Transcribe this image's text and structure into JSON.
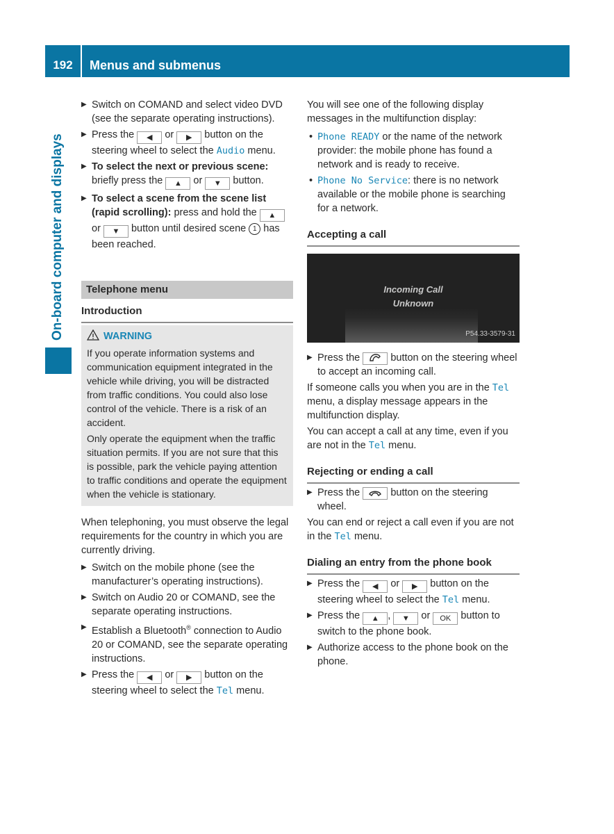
{
  "header": {
    "page_number": "192",
    "title": "Menus and submenus"
  },
  "side_tab": {
    "label": "On-board computer and displays"
  },
  "left": {
    "steps_top": [
      {
        "text": "Switch on COMAND and select video DVD (see the separate operating instructions)."
      },
      {
        "pre": "Press the",
        "key1": "◀",
        "mid": "or",
        "key2": "▶",
        "post": "button on the steering wheel to select the",
        "mono": "Audio",
        "end": "menu."
      },
      {
        "bold": "To select the next or previous scene:",
        "pre": "briefly press the",
        "key1": "▲",
        "mid": "or",
        "key2": "▼",
        "post": "button."
      },
      {
        "bold": "To select a scene from the scene list (rapid scrolling):",
        "pre": "press and hold the",
        "key1": "▲",
        "mid": "or",
        "key2": "▼",
        "post": "button until desired scene",
        "circ": "1",
        "end": "has been reached."
      }
    ],
    "section_title": "Telephone menu",
    "intro_heading": "Introduction",
    "warning": {
      "title": "WARNING",
      "p1": "If you operate information systems and communication equipment integrated in the vehicle while driving, you will be distracted from traffic conditions. You could also lose control of the vehicle. There is a risk of an accident.",
      "p2": "Only operate the equipment when the traffic situation permits. If you are not sure that this is possible, park the vehicle paying attention to traffic conditions and operate the equipment when the vehicle is stationary."
    },
    "intro_para": "When telephoning, you must observe the legal requirements for the country in which you are currently driving.",
    "steps_bottom": [
      {
        "text": "Switch on the mobile phone (see the manufacturer’s operating instructions)."
      },
      {
        "text": "Switch on Audio 20 or COMAND, see the separate operating instructions."
      },
      {
        "pre": "Establish a Bluetooth",
        "sup": "®",
        "post": " connection to Audio 20 or COMAND, see the separate operating instructions."
      },
      {
        "pre": "Press the",
        "key1": "◀",
        "mid": "or",
        "key2": "▶",
        "post": "button on the steering wheel to select the",
        "mono": "Tel",
        "end": "menu."
      }
    ]
  },
  "right": {
    "intro": "You will see one of the following display messages in the multifunction display:",
    "bullets": [
      {
        "mono": "Phone READY",
        "text": " or the name of the network provider: the mobile phone has found a network and is ready to receive."
      },
      {
        "mono": "Phone No Service",
        "text": ": there is no network available or the mobile phone is searching for a network."
      }
    ],
    "accept": {
      "heading": "Accepting a call",
      "screen": {
        "line1": "Incoming Call",
        "line2": "Unknown",
        "code": "P54.33-3579-31"
      },
      "step": {
        "pre": "Press the",
        "key_icon": "phone-accept-icon",
        "post": "button on the steering wheel to accept an incoming call."
      },
      "p1_pre": "If someone calls you when you are in the",
      "p1_mono": "Tel",
      "p1_post": "menu, a display message appears in the multifunction display.",
      "p2_pre": "You can accept a call at any time, even if you are not in the",
      "p2_mono": "Tel",
      "p2_post": "menu."
    },
    "reject": {
      "heading": "Rejecting or ending a call",
      "step": {
        "pre": "Press the",
        "key_icon": "phone-hangup-icon",
        "post": "button on the steering wheel."
      },
      "p_pre": "You can end or reject a call even if you are not in the",
      "p_mono": "Tel",
      "p_post": "menu."
    },
    "dial": {
      "heading": "Dialing an entry from the phone book",
      "step1": {
        "pre": "Press the",
        "key1": "◀",
        "mid": "or",
        "key2": "▶",
        "post": "button on the steering wheel to select the",
        "mono": "Tel",
        "end": "menu."
      },
      "step2": {
        "pre": "Press the",
        "key1": "▲",
        "sep": ",",
        "key2": "▼",
        "mid": "or",
        "key3": "OK",
        "post": "button to switch to the phone book."
      },
      "step3": {
        "text": "Authorize access to the phone book on the phone."
      }
    }
  },
  "colors": {
    "brand_blue": "#0a75a3",
    "link_mono": "#1a87b6",
    "warning_bg": "#e6e6e6",
    "section_bg": "#c8c8c8"
  }
}
